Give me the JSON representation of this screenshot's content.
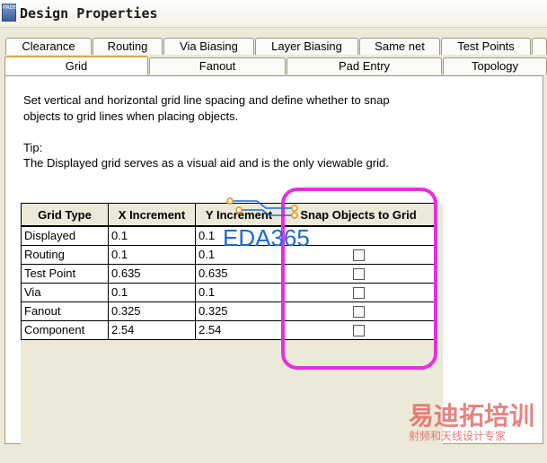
{
  "window": {
    "title": "Design Properties",
    "icon_text": "PADS"
  },
  "tabs_row1": [
    "Clearance",
    "Routing",
    "Via Biasing",
    "Layer Biasing",
    "Same net",
    "Test Points"
  ],
  "tabs_row2": [
    "Grid",
    "Fanout",
    "Pad Entry",
    "Topology"
  ],
  "active_tab": "Grid",
  "panel": {
    "description_line1": "Set vertical and horizontal grid line spacing and define whether to snap",
    "description_line2": "objects to grid lines when placing objects.",
    "tip_label": "Tip:",
    "tip_text": "The Displayed grid serves as a visual aid and is the only viewable grid."
  },
  "grid_table": {
    "headers": [
      "Grid Type",
      "X Increment",
      "Y Increment",
      "Snap Objects to Grid"
    ],
    "rows": [
      {
        "type": "Displayed",
        "x": "0.1",
        "y": "0.1",
        "snap": null
      },
      {
        "type": "Routing",
        "x": "0.1",
        "y": "0.1",
        "snap": false
      },
      {
        "type": "Test Point",
        "x": "0.635",
        "y": "0.635",
        "snap": false
      },
      {
        "type": "Via",
        "x": "0.1",
        "y": "0.1",
        "snap": false
      },
      {
        "type": "Fanout",
        "x": "0.325",
        "y": "0.325",
        "snap": false
      },
      {
        "type": "Component",
        "x": "2.54",
        "y": "2.54",
        "snap": false
      }
    ]
  },
  "watermarks": {
    "eda": "EDA365",
    "cn_main": "易迪拓培训",
    "cn_sub": "射频和天线设计专家"
  },
  "colors": {
    "highlight": "#e82ee0",
    "active_tab_border": "#e8a33d",
    "eda_blue": "#1a6bd6",
    "watermark_red": "#e05a5a"
  }
}
